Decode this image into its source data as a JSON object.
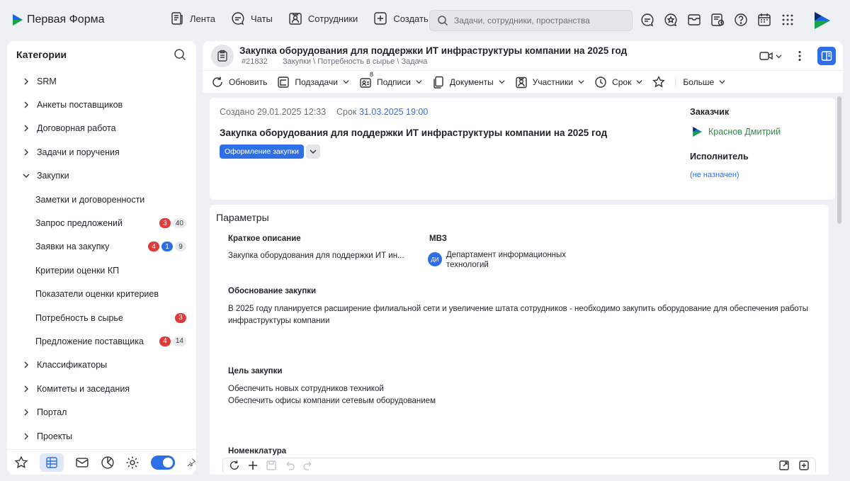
{
  "app": {
    "title": "Первая Форма"
  },
  "nav": {
    "feed": "Лента",
    "chats": "Чаты",
    "employees": "Сотрудники",
    "create": "Создать"
  },
  "search": {
    "placeholder": "Задачи, сотрудники, пространства"
  },
  "sidebar": {
    "title": "Категории",
    "items": [
      {
        "label": "SRM",
        "expanded": false
      },
      {
        "label": "Анкеты поставщиков",
        "expanded": false
      },
      {
        "label": "Договорная работа",
        "expanded": false
      },
      {
        "label": "Задачи и поручения",
        "expanded": false
      },
      {
        "label": "Закупки",
        "expanded": true
      }
    ],
    "children": [
      {
        "label": "Заметки и договоренности"
      },
      {
        "label": "Запрос предложений",
        "badges": [
          "3",
          "40"
        ]
      },
      {
        "label": "Заявки на закупку",
        "badges": [
          "4",
          "1",
          "9"
        ]
      },
      {
        "label": "Критерии оценки КП"
      },
      {
        "label": "Показатели оценки критериев"
      },
      {
        "label": "Потребность в сырье",
        "badges": [
          "3"
        ]
      },
      {
        "label": "Предложение поставщика",
        "badges": [
          "4",
          "14"
        ]
      }
    ],
    "items_after": [
      {
        "label": "Классификаторы"
      },
      {
        "label": "Комитеты и заседания"
      },
      {
        "label": "Портал"
      },
      {
        "label": "Проекты"
      }
    ]
  },
  "doc": {
    "title": "Закупка оборудования для поддержки ИТ инфраструктуры компании на 2025 год",
    "id": "#21832",
    "path": "Закупки \\ Потребность в сырье \\ Задача"
  },
  "toolbar": {
    "refresh": "Обновить",
    "subtasks": "Подзадачи",
    "signatures": "Подписи",
    "signatures_count": "8",
    "documents": "Документы",
    "participants": "Участники",
    "deadline": "Срок",
    "more": "Больше"
  },
  "card": {
    "created": "Создано 29.01.2025 12:33",
    "deadline_label": "Срок",
    "deadline_value": "31.03.2025 19:00",
    "title": "Закупка оборудования для поддержки ИТ инфраструктуры компании на 2025 год",
    "status": "Оформление закупки",
    "customer_label": "Заказчик",
    "customer_value": "Краснов Дмитрий",
    "executor_label": "Исполнитель",
    "executor_value": "(не назначен)"
  },
  "params": {
    "title": "Параметры",
    "short_desc_label": "Краткое описание",
    "short_desc_value": "Закупка оборудования для поддержки ИТ ин...",
    "mvz_label": "МВЗ",
    "mvz_avatar": "ДИ",
    "mvz_value_line1": "Департамент информационных",
    "mvz_value_line2": "технологий",
    "justification_label": "Обоснование закупки",
    "justification_line1": "В 2025 году планируется расширение филиальной сети и увеличение штата сотрудников - необходимо закупить оборудование для обеспечения работы",
    "justification_line2": "инфраструктуры компании",
    "goal_label": "Цель закупки",
    "goal_line1": "Обеспечить новых сотрудников техникой",
    "goal_line2": "Обеспечить офисы компании сетевым оборудованием",
    "nomenclature_label": "Номенклатура"
  },
  "colors": {
    "accent": "#2f6fe6",
    "badge_red": "#e03a3a",
    "customer_green": "#2e8b46"
  }
}
